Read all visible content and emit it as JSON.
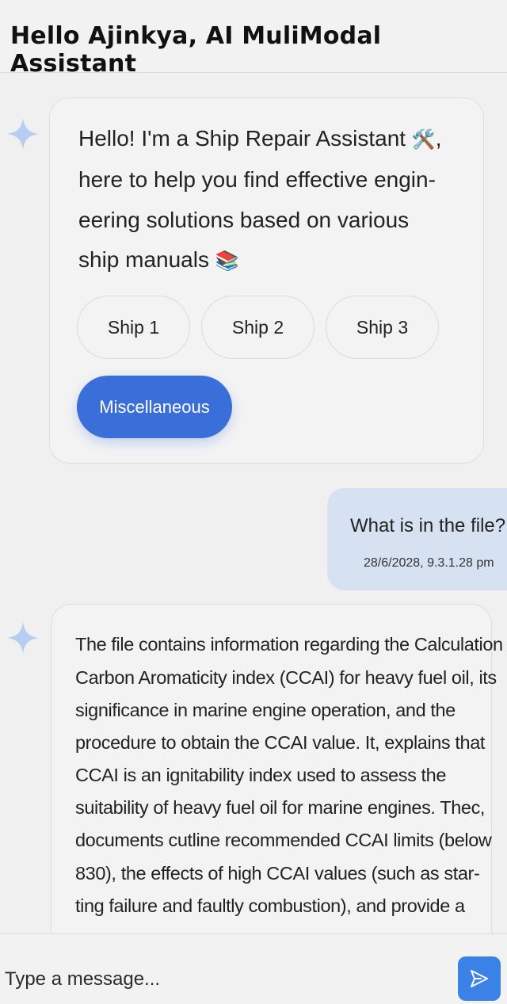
{
  "header": {
    "title": "Hello Ajinkya, AI MuliModal Assistant"
  },
  "welcome": {
    "lines": [
      "Hello! I'm a Ship Repair Assistant",
      "here to help you find effective engin-",
      "eering solutions based on various",
      "ship manuals"
    ],
    "tools_emoji": "🛠️",
    "manuals_emoji": "📚",
    "chips": [
      "Ship 1",
      "Ship 2",
      "Ship 3"
    ],
    "primary_chip": "Miscellaneous"
  },
  "user_message": {
    "text": "What is in the file?",
    "timestamp": "28/6/2028, 9.3.1.28 pm"
  },
  "assistant_answer": {
    "lines": [
      "The file contains information regarding the Calculation",
      "Carbon Aromaticity index (CCAI) for heavy fuel oil, its",
      "significance in marine engine operation, and the",
      "procedure to obtain the CCAI value. It, explains that",
      "CCAI is an ignitability index used to assess the",
      "suitability of heavy fuel oil for marine engines. Thec,",
      "documents cutline recommended CCAI limits (below",
      "830), the effects of high CCAI values (such as star-",
      "ting failure and faultly combustion), and provide a"
    ]
  },
  "composer": {
    "placeholder": "Type a message..."
  },
  "icons": {
    "assistant": "sparkle-icon",
    "send": "send-icon"
  },
  "colors": {
    "accent": "#3a6fd9",
    "send": "#3b82e6",
    "user_bubble": "#d6e2f2",
    "sparkle": "#b4cdf0"
  }
}
